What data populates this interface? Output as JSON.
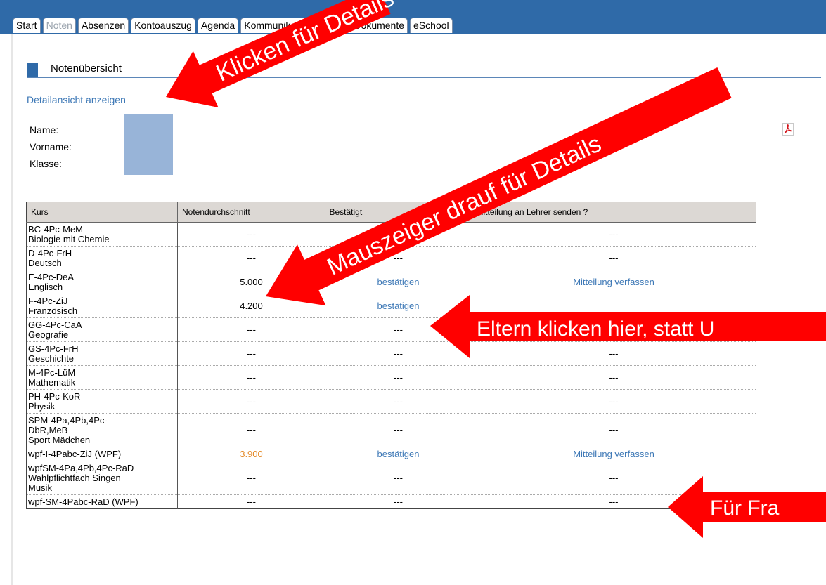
{
  "tabs": [
    {
      "label": "Start"
    },
    {
      "label": "Noten"
    },
    {
      "label": "Absenzen"
    },
    {
      "label": "Kontoauszug"
    },
    {
      "label": "Agenda"
    },
    {
      "label": "Kommunikation"
    },
    {
      "label": "Listen&Dokumente"
    },
    {
      "label": "eSchool"
    }
  ],
  "section": {
    "title": "Notenübersicht",
    "detail_link": "Detailansicht anzeigen"
  },
  "person": {
    "name_label": "Name:",
    "vorname_label": "Vorname:",
    "klasse_label": "Klasse:"
  },
  "table": {
    "headers": [
      "Kurs",
      "Notendurchschnitt",
      "Bestätigt",
      "Mitteilung an Lehrer senden ?"
    ],
    "rows": [
      {
        "course": "BC-4Pc-MeM\nBiologie mit Chemie",
        "avg": "---",
        "confirmed": "---",
        "message": "---"
      },
      {
        "course": "D-4Pc-FrH\nDeutsch",
        "avg": "---",
        "confirmed": "---",
        "message": "---"
      },
      {
        "course": "E-4Pc-DeA\nEnglisch",
        "avg": "5.000",
        "confirmed": "bestätigen",
        "message": "Mitteilung verfassen"
      },
      {
        "course": "F-4Pc-ZiJ\nFranzösisch",
        "avg": "4.200",
        "confirmed": "bestätigen",
        "message": ""
      },
      {
        "course": "GG-4Pc-CaA\nGeografie",
        "avg": "---",
        "confirmed": "---",
        "message": "---"
      },
      {
        "course": "GS-4Pc-FrH\nGeschichte",
        "avg": "---",
        "confirmed": "---",
        "message": "---"
      },
      {
        "course": "M-4Pc-LüM\nMathematik",
        "avg": "---",
        "confirmed": "---",
        "message": "---"
      },
      {
        "course": "PH-4Pc-KoR\nPhysik",
        "avg": "---",
        "confirmed": "---",
        "message": "---"
      },
      {
        "course": "SPM-4Pa,4Pb,4Pc-\nDbR,MeB\nSport Mädchen",
        "avg": "---",
        "confirmed": "---",
        "message": "---"
      },
      {
        "course": "wpf-I-4Pabc-ZiJ (WPF)",
        "avg": "3.900",
        "confirmed": "bestätigen",
        "message": "Mitteilung verfassen"
      },
      {
        "course": "wpfSM-4Pa,4Pb,4Pc-RaD\nWahlpflichtfach Singen\nMusik",
        "avg": "---",
        "confirmed": "---",
        "message": "---"
      },
      {
        "course": "wpf-SM-4Pabc-RaD (WPF)",
        "avg": "---",
        "confirmed": "---",
        "message": "---"
      }
    ]
  },
  "annotations": {
    "click_details": "Klicken für Details",
    "hover_details": "Mauszeiger drauf für Details",
    "parents_click": "Eltern klicken hier, statt U",
    "questions": "Für Fra"
  },
  "colors": {
    "topbar": "#2f6aa8",
    "link": "#3d78b6",
    "orange_avg": "#e48a28",
    "arrow": "#ff0000"
  }
}
